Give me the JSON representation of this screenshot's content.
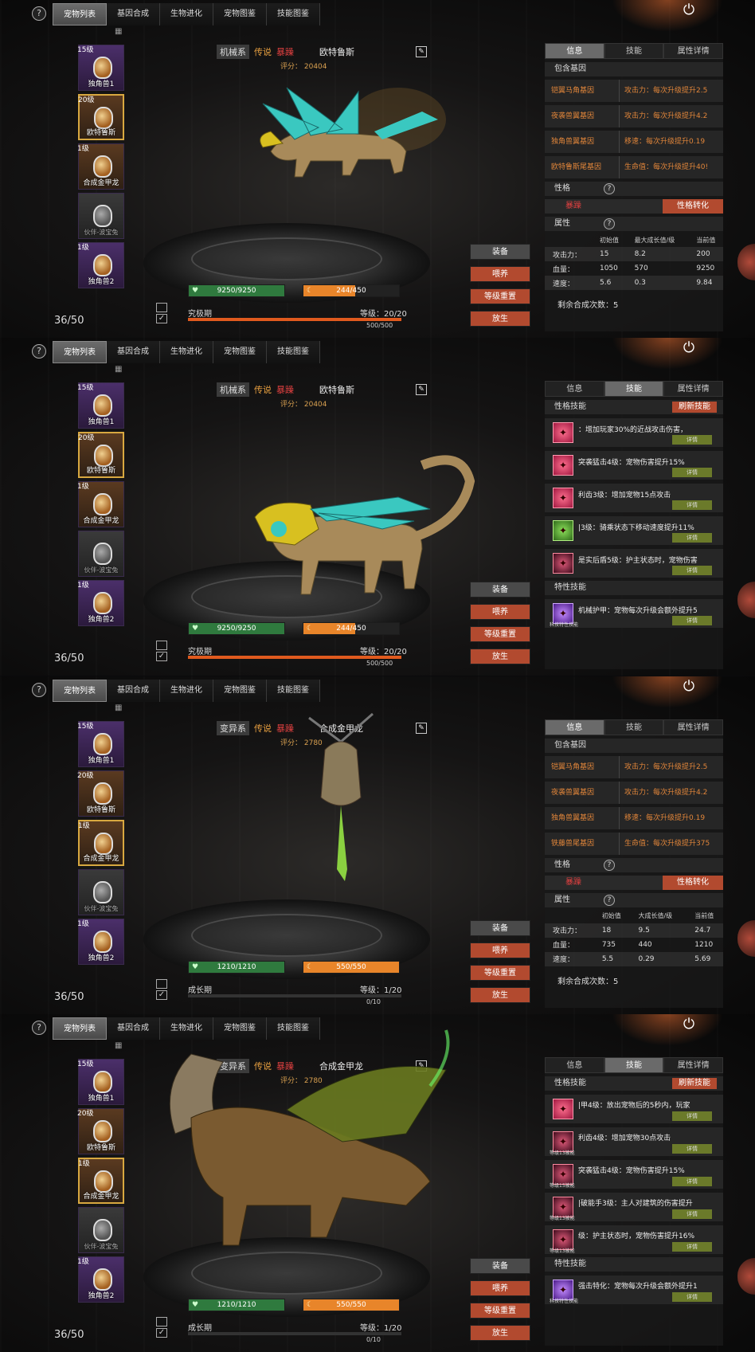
{
  "tabs": [
    "宠物列表",
    "基因合成",
    "生物进化",
    "宠物图鉴",
    "技能图鉴"
  ],
  "capacity": "36/50",
  "buttons": {
    "equip": "装备",
    "feed": "喂养",
    "reset": "等级重置",
    "release": "放生"
  },
  "info_tabs": [
    "信息",
    "技能",
    "属性详情"
  ],
  "labels": {
    "genes": "包含基因",
    "nature": "性格",
    "nature_change": "性格转化",
    "attrs": "属性",
    "attr_h": [
      "初始值",
      "最大成长值/级",
      "当前值"
    ],
    "attr_h2": [
      "初始值",
      "大成长值/级",
      "当前值"
    ],
    "remain": "剩余合成次数：5",
    "nature_skills": "性格技能",
    "refresh": "刷新技能",
    "special_skills": "特性技能",
    "detail": "详情",
    "score_prefix": "评分：",
    "hp_label": "血量：",
    "atk_label": "攻击力：",
    "spd_label": "速度："
  },
  "pet_list": [
    {
      "lvl": "15级",
      "name": "独角兽1"
    },
    {
      "lvl": "20级",
      "name": "欧特鲁斯"
    },
    {
      "lvl": "1级",
      "name": "合成金甲龙"
    },
    {
      "lvl": "",
      "name": "伙伴-波宝兔"
    },
    {
      "lvl": "1级",
      "name": "独角兽2"
    }
  ],
  "panels": [
    {
      "pet": {
        "type": "机械系",
        "rarity": "传说",
        "nature": "暴躁",
        "name": "欧特鲁斯",
        "score": "20404"
      },
      "hp": "9250/9250",
      "xp": "244/450",
      "xp_fill": 0.54,
      "stage": "究极期",
      "level": "等级：20/20",
      "exp": "500/500",
      "lv_fill": 1.0,
      "genes": [
        {
          "g": "铠翼马角基因",
          "e": "攻击力：每次升级提升2.5"
        },
        {
          "g": "夜袭兽翼基因",
          "e": "攻击力：每次升级提升4.2"
        },
        {
          "g": "独角兽翼基因",
          "e": "移速：每次升级提升0.19"
        },
        {
          "g": "欧特鲁斯尾基因",
          "e": "生命值：每次升级提升40!"
        }
      ],
      "nature_value": "暴躁",
      "attrs": [
        [
          "攻击力：",
          "15",
          "8.2",
          "200"
        ],
        [
          "血量：",
          "1050",
          "570",
          "9250"
        ],
        [
          "速度：",
          "5.6",
          "0.3",
          "9.84"
        ]
      ]
    },
    {
      "pet": {
        "type": "机械系",
        "rarity": "传说",
        "nature": "暴躁",
        "name": "欧特鲁斯",
        "score": "20404"
      },
      "hp": "9250/9250",
      "xp": "244/450",
      "xp_fill": 0.54,
      "stage": "究极期",
      "level": "等级：20/20",
      "exp": "500/500",
      "lv_fill": 1.0,
      "skills": [
        {
          "t": "：增加玩家30%的近战攻击伤害，",
          "c": ""
        },
        {
          "t": "突袭猛击4级：宠物伤害提升15%",
          "c": ""
        },
        {
          "t": "利齿3级：增加宠物15点攻击",
          "c": ""
        },
        {
          "t": "|3级：骑乘状态下移动速度提升11%",
          "c": "green"
        },
        {
          "t": "是实后盾5级：护主状态时，宠物伤害",
          "c": "dark"
        }
      ],
      "special": {
        "t": "机械护甲：宠物每次升级会额外提升5",
        "sub": "科技特性技能"
      }
    },
    {
      "pet": {
        "type": "变异系",
        "rarity": "传说",
        "nature": "暴躁",
        "name": "合成金甲龙",
        "score": "2780"
      },
      "hp": "1210/1210",
      "xp": "550/550",
      "xp_fill": 1.0,
      "stage": "成长期",
      "level": "等级：1/20",
      "exp": "0/10",
      "lv_fill": 0.0,
      "genes": [
        {
          "g": "铠翼马角基因",
          "e": "攻击力：每次升级提升2.5"
        },
        {
          "g": "夜袭兽翼基因",
          "e": "攻击力：每次升级提升4.2"
        },
        {
          "g": "独角兽翼基因",
          "e": "移速：每次升级提升0.19"
        },
        {
          "g": "铁藤兽尾基因",
          "e": "生命值：每次升级提升375"
        }
      ],
      "nature_value": "暴躁",
      "attrs": [
        [
          "攻击力：",
          "18",
          "9.5",
          "24.7"
        ],
        [
          "血量：",
          "735",
          "440",
          "1210"
        ],
        [
          "速度：",
          "5.5",
          "0.29",
          "5.69"
        ]
      ]
    },
    {
      "pet": {
        "type": "变异系",
        "rarity": "传说",
        "nature": "暴躁",
        "name": "合成金甲龙",
        "score": "2780"
      },
      "hp": "1210/1210",
      "xp": "550/550",
      "xp_fill": 1.0,
      "stage": "成长期",
      "level": "等级：1/20",
      "exp": "0/10",
      "lv_fill": 0.0,
      "skills": [
        {
          "t": "|甲4级：放出宠物后的5秒内，玩家",
          "c": ""
        },
        {
          "t": "利齿4级：增加宠物30点攻击",
          "c": "dark",
          "sub": "等级13被能"
        },
        {
          "t": "突袭猛击4级：宠物伤害提升15%",
          "c": "dark",
          "sub": "等级15被能"
        },
        {
          "t": "|破能手3级：主人对建筑的伤害提升",
          "c": "dark",
          "sub": "等级13被能"
        },
        {
          "t": "级：护主状态时，宠物伤害提升16%",
          "c": "dark",
          "sub": "等级13被能"
        }
      ],
      "special": {
        "t": "强击特化：宠物每次升级会额外提升1",
        "sub": "科技特性技能"
      }
    }
  ]
}
